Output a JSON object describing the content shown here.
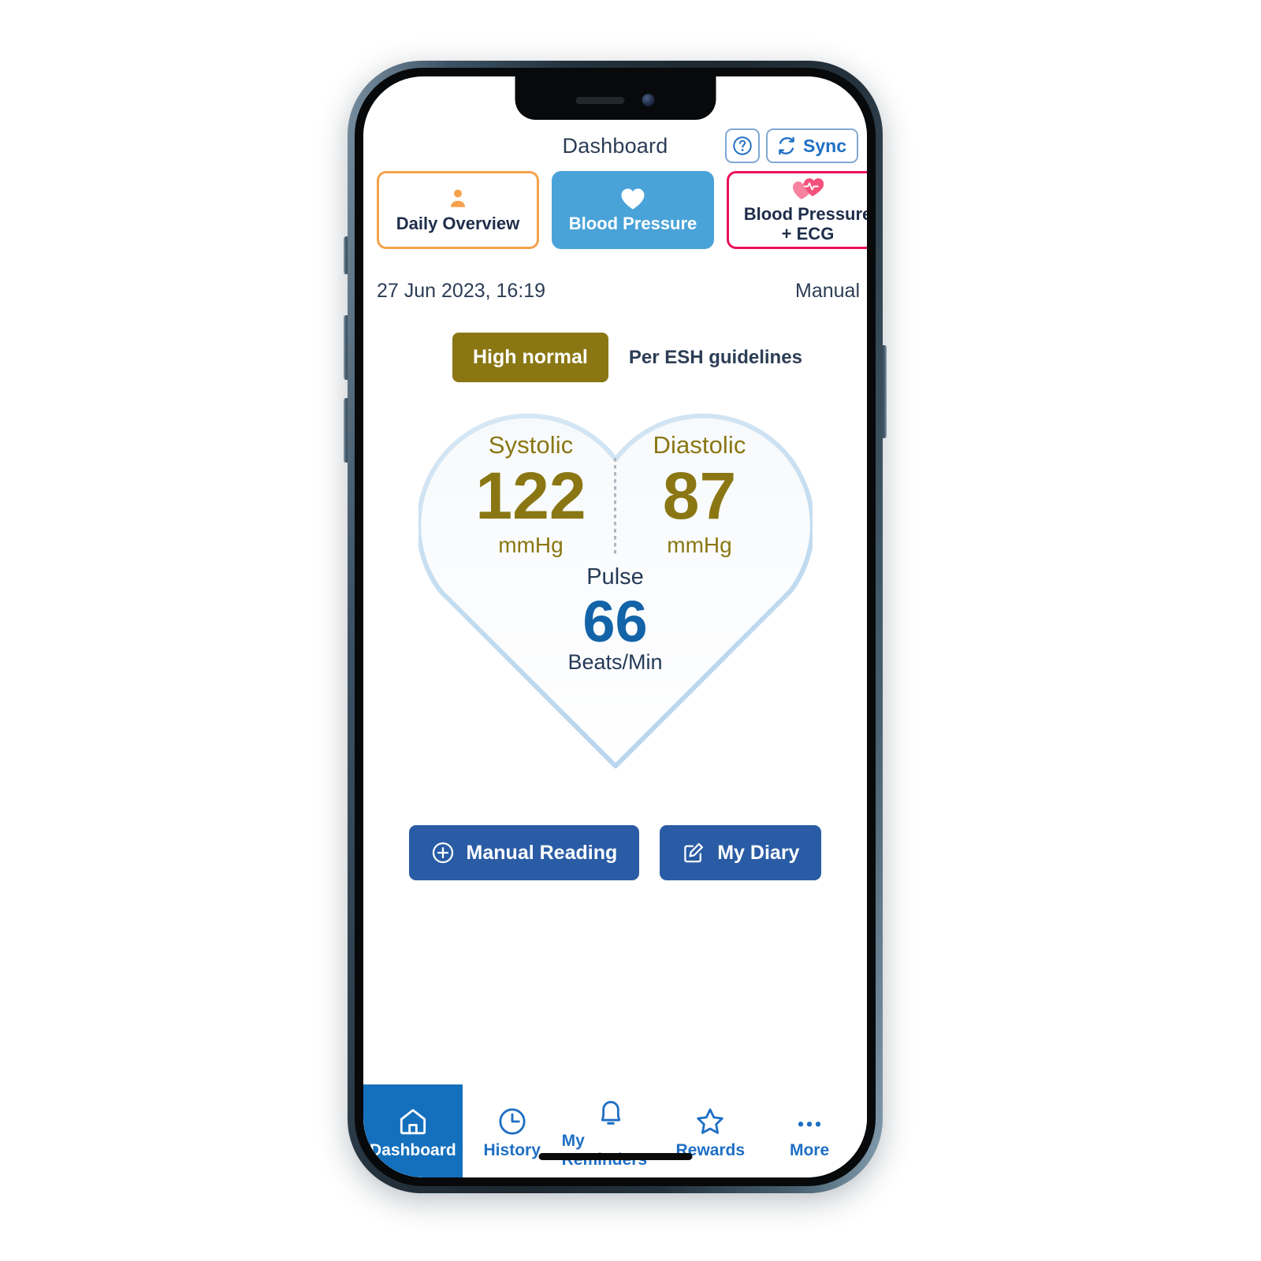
{
  "header": {
    "title": "Dashboard",
    "help_icon": "question-mark-circle-icon",
    "sync_label": "Sync",
    "sync_icon": "refresh-sync-icon"
  },
  "tabs": [
    {
      "label": "Daily Overview",
      "icon": "person-icon",
      "style": "outline-orange",
      "accent": "#f5a14b",
      "selected": false
    },
    {
      "label": "Blood Pressure",
      "icon": "heart-filled-icon",
      "style": "filled-blue",
      "accent": "#4aa3d8",
      "selected": true
    },
    {
      "label": "Blood Pressure\n+ ECG",
      "label_line1": "Blood Pressure",
      "label_line2": "+ ECG",
      "icon": "heart-ecg-icon",
      "style": "outline-pink",
      "accent": "#ec0f5e",
      "selected": false
    }
  ],
  "reading": {
    "timestamp": "27 Jun 2023, 16:19",
    "source": "Manual",
    "classification": "High normal",
    "classification_color": "#8a7714",
    "guideline_note": "Per ESH guidelines",
    "systolic": {
      "name": "Systolic",
      "value": "122",
      "unit": "mmHg"
    },
    "diastolic": {
      "name": "Diastolic",
      "value": "87",
      "unit": "mmHg"
    },
    "pulse": {
      "name": "Pulse",
      "value": "66",
      "unit": "Beats/Min",
      "color": "#1263a8"
    }
  },
  "actions": [
    {
      "label": "Manual Reading",
      "icon": "plus-circle-icon"
    },
    {
      "label": "My Diary",
      "icon": "pencil-note-icon"
    }
  ],
  "bottom_nav": [
    {
      "label": "Dashboard",
      "icon": "home-icon",
      "active": true
    },
    {
      "label": "History",
      "icon": "clock-icon",
      "active": false
    },
    {
      "label": "My Reminders",
      "icon": "bell-icon",
      "active": false
    },
    {
      "label": "Rewards",
      "icon": "star-icon",
      "active": false
    },
    {
      "label": "More",
      "icon": "ellipsis-icon",
      "active": false
    }
  ],
  "colors": {
    "primary_blue": "#1470bd",
    "button_blue": "#2a5ca5",
    "tab_blue": "#4aa3d8",
    "olive": "#8a7714",
    "orange": "#f5a14b",
    "pink": "#ec0f5e",
    "text_dark": "#2c3d55"
  }
}
